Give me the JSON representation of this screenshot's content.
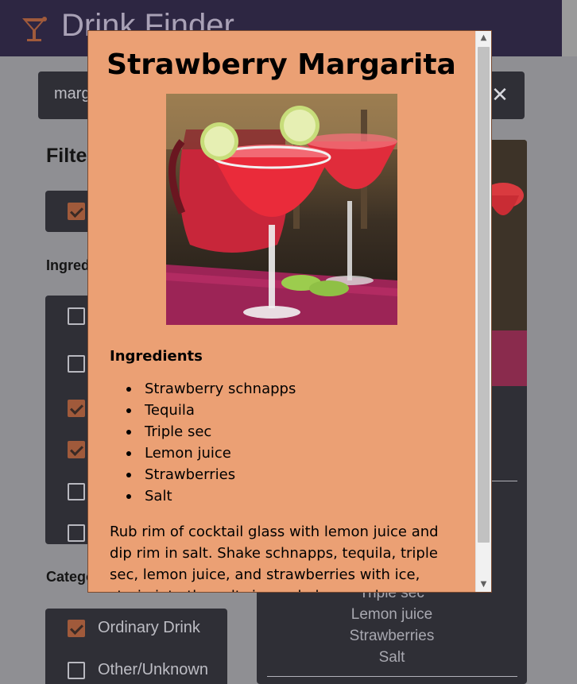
{
  "app": {
    "title": "Drink Finder",
    "logo_icon": "cocktail-glass-icon"
  },
  "search": {
    "value": "margarita",
    "clear_icon": "close-icon"
  },
  "filters": {
    "title": "Filters",
    "top_option_checked": true,
    "ingredients_label": "Ingredients",
    "ingredient_checks": [
      false,
      false,
      true,
      true,
      false,
      false
    ],
    "category_label": "Category",
    "categories": [
      {
        "label": "Ordinary Drink",
        "checked": true
      },
      {
        "label": "Other/Unknown",
        "checked": false
      }
    ]
  },
  "result_card": {
    "ingredients": [
      "Triple sec",
      "Lemon juice",
      "Strawberries",
      "Salt"
    ]
  },
  "modal": {
    "title": "Strawberry Margarita",
    "ingredients_heading": "Ingredients",
    "ingredients": [
      "Strawberry schnapps",
      "Tequila",
      "Triple sec",
      "Lemon juice",
      "Strawberries",
      "Salt"
    ],
    "instructions": "Rub rim of cocktail glass with lemon juice and dip rim in salt. Shake schnapps, tequila, triple sec, lemon juice, and strawberries with ice, strain into the salt-rimmed glass, and serve."
  },
  "colors": {
    "header_bg": "#2d2642",
    "modal_bg": "#eba074",
    "panel_bg": "#2f2f36",
    "checkbox_checked": "#a05a3b"
  }
}
